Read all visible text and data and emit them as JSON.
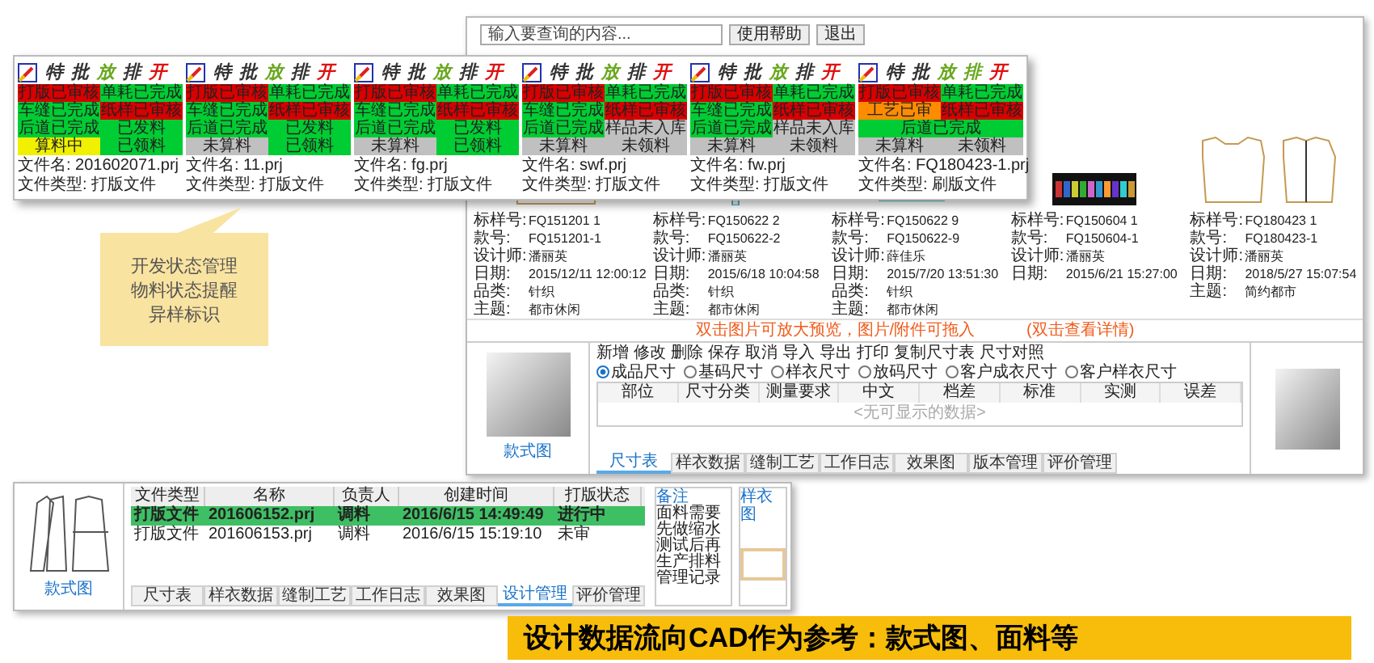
{
  "main_window": {
    "search": {
      "placeholder": "输入要查询的内容..."
    },
    "buttons": [
      "使用帮助",
      "退出"
    ],
    "styles": [
      {
        "kind": "curve",
        "fields": [
          {
            "label": "标样号:",
            "value": "FQ151201 1"
          },
          {
            "label": "款号:",
            "value": "FQ151201-1"
          },
          {
            "label": "设计师:",
            "value": "潘丽英"
          },
          {
            "label": "日期:",
            "value": "2015/12/11 12:00:12"
          },
          {
            "label": "品类:",
            "value": "针织"
          },
          {
            "label": "主题:",
            "value": "都市休闲"
          }
        ]
      },
      {
        "kind": "ruler",
        "fields": [
          {
            "label": "标样号:",
            "value": "FQ150622 2"
          },
          {
            "label": "款号:",
            "value": "FQ150622-2"
          },
          {
            "label": "设计师:",
            "value": "潘丽英"
          },
          {
            "label": "日期:",
            "value": "2015/6/18 10:04:58"
          },
          {
            "label": "品类:",
            "value": "针织"
          },
          {
            "label": "主题:",
            "value": "都市休闲"
          }
        ]
      },
      {
        "kind": "pattern",
        "fields": [
          {
            "label": "标样号:",
            "value": "FQ150622 9"
          },
          {
            "label": "款号:",
            "value": "FQ150622-9"
          },
          {
            "label": "设计师:",
            "value": "薛佳乐"
          },
          {
            "label": "日期:",
            "value": "2015/7/20 13:51:30"
          },
          {
            "label": "品类:",
            "value": "针织"
          },
          {
            "label": "主题:",
            "value": "都市休闲"
          }
        ]
      },
      {
        "kind": "fabric",
        "fields": [
          {
            "label": "标样号:",
            "value": "FQ150604 1"
          },
          {
            "label": "款号:",
            "value": "FQ150604-1"
          },
          {
            "label": "设计师:",
            "value": "潘丽英"
          },
          {
            "label": "日期:",
            "value": "2015/6/21 15:27:00"
          }
        ]
      },
      {
        "kind": "vest",
        "fields": [
          {
            "label": "标样号:",
            "value": "FQ180423 1"
          },
          {
            "label": "款号:",
            "value": "FQ180423-1"
          },
          {
            "label": "设计师:",
            "value": "潘丽英"
          },
          {
            "label": "日期:",
            "value": "2018/5/27 15:07:54"
          },
          {
            "label": "主题:",
            "value": "简约都市"
          }
        ]
      }
    ],
    "notice": "双击图片可放大预览，图片/附件可拖入",
    "notice_2": "(双击查看详情)",
    "photo_caption": "款式图",
    "toolbar": [
      "新增",
      "修改",
      "删除",
      "保存",
      "取消",
      "导入",
      "导出",
      "打印",
      "复制尺寸表",
      "尺寸对照"
    ],
    "radios": [
      {
        "label": "成品尺寸",
        "selected": true
      },
      {
        "label": "基码尺寸",
        "selected": false
      },
      {
        "label": "样衣尺寸",
        "selected": false
      },
      {
        "label": "放码尺寸",
        "selected": false
      },
      {
        "label": "客户成衣尺寸",
        "selected": false
      },
      {
        "label": "客户样衣尺寸",
        "selected": false
      }
    ],
    "size_table": {
      "columns": [
        "部位",
        "尺寸分类",
        "测量要求",
        "中文",
        "档差",
        "标准",
        "实测",
        "误差"
      ],
      "empty": "<无可显示的数据>"
    },
    "tabs": [
      {
        "label": "尺寸表",
        "selected": true
      },
      {
        "label": "样衣数据",
        "selected": false
      },
      {
        "label": "缝制工艺",
        "selected": false
      },
      {
        "label": "工作日志",
        "selected": false
      },
      {
        "label": "效果图",
        "selected": false
      },
      {
        "label": "版本管理",
        "selected": false
      },
      {
        "label": "评价管理",
        "selected": false
      }
    ]
  },
  "status_popup": {
    "cards": [
      {
        "logo": [
          {
            "char": "特",
            "color": "#333333"
          },
          {
            "char": "批",
            "color": "#333333"
          },
          {
            "char": "放",
            "color": "#6aa820"
          },
          {
            "char": "排",
            "color": "#333333"
          },
          {
            "char": "开",
            "color": "#e01010"
          }
        ],
        "chips": [
          {
            "label": "打版已审核",
            "color": "#d80000",
            "kind": "half"
          },
          {
            "label": "单耗已完成",
            "color": "#00cc33",
            "kind": "half"
          },
          {
            "label": "车缝已完成",
            "color": "#00cc33",
            "kind": "half"
          },
          {
            "label": "纸样已审核",
            "color": "#d80000",
            "kind": "half"
          },
          {
            "label": "后道已完成",
            "color": "#00cc33",
            "kind": "half"
          },
          {
            "label": "已发料",
            "color": "#00cc33",
            "kind": "half"
          },
          {
            "label": "算料中",
            "color": "#f0f000",
            "kind": "half"
          },
          {
            "label": "已领料",
            "color": "#00cc33",
            "kind": "half"
          }
        ],
        "file_name": "文件名:  201602071.prj",
        "file_type": "文件类型:  打版文件"
      },
      {
        "logo": [
          {
            "char": "特",
            "color": "#333333"
          },
          {
            "char": "批",
            "color": "#333333"
          },
          {
            "char": "放",
            "color": "#6aa820"
          },
          {
            "char": "排",
            "color": "#333333"
          },
          {
            "char": "开",
            "color": "#e01010"
          }
        ],
        "chips": [
          {
            "label": "打版已审核",
            "color": "#d80000",
            "kind": "half"
          },
          {
            "label": "单耗已完成",
            "color": "#00cc33",
            "kind": "half"
          },
          {
            "label": "车缝已完成",
            "color": "#00cc33",
            "kind": "half"
          },
          {
            "label": "纸样已审核",
            "color": "#d80000",
            "kind": "half"
          },
          {
            "label": "后道已完成",
            "color": "#00cc33",
            "kind": "half"
          },
          {
            "label": "已发料",
            "color": "#00cc33",
            "kind": "half"
          },
          {
            "label": "未算料",
            "color": "#c0c0c0",
            "kind": "half"
          },
          {
            "label": "已领料",
            "color": "#00cc33",
            "kind": "half"
          }
        ],
        "file_name": "文件名:  11.prj",
        "file_type": "文件类型:  打版文件"
      },
      {
        "logo": [
          {
            "char": "特",
            "color": "#333333"
          },
          {
            "char": "批",
            "color": "#333333"
          },
          {
            "char": "放",
            "color": "#6aa820"
          },
          {
            "char": "排",
            "color": "#333333"
          },
          {
            "char": "开",
            "color": "#e01010"
          }
        ],
        "chips": [
          {
            "label": "打版已审核",
            "color": "#d80000",
            "kind": "half"
          },
          {
            "label": "单耗已完成",
            "color": "#00cc33",
            "kind": "half"
          },
          {
            "label": "车缝已完成",
            "color": "#00cc33",
            "kind": "half"
          },
          {
            "label": "纸样已审核",
            "color": "#d80000",
            "kind": "half"
          },
          {
            "label": "后道已完成",
            "color": "#00cc33",
            "kind": "half"
          },
          {
            "label": "已发料",
            "color": "#00cc33",
            "kind": "half"
          },
          {
            "label": "未算料",
            "color": "#c0c0c0",
            "kind": "half"
          },
          {
            "label": "已领料",
            "color": "#00cc33",
            "kind": "half"
          }
        ],
        "file_name": "文件名:  fg.prj",
        "file_type": "文件类型:  打版文件"
      },
      {
        "logo": [
          {
            "char": "特",
            "color": "#333333"
          },
          {
            "char": "批",
            "color": "#333333"
          },
          {
            "char": "放",
            "color": "#6aa820"
          },
          {
            "char": "排",
            "color": "#333333"
          },
          {
            "char": "开",
            "color": "#e01010"
          }
        ],
        "chips": [
          {
            "label": "打版已审核",
            "color": "#d80000",
            "kind": "half"
          },
          {
            "label": "单耗已完成",
            "color": "#00cc33",
            "kind": "half"
          },
          {
            "label": "车缝已完成",
            "color": "#00cc33",
            "kind": "half"
          },
          {
            "label": "纸样已审核",
            "color": "#d80000",
            "kind": "half"
          },
          {
            "label": "后道已完成",
            "color": "#00cc33",
            "kind": "half"
          },
          {
            "label": "样品未入库",
            "color": "#c0c0c0",
            "kind": "half"
          },
          {
            "label": "未算料",
            "color": "#c0c0c0",
            "kind": "half"
          },
          {
            "label": "未领料",
            "color": "#c0c0c0",
            "kind": "half"
          }
        ],
        "file_name": "文件名:  swf.prj",
        "file_type": "文件类型:  打版文件"
      },
      {
        "logo": [
          {
            "char": "特",
            "color": "#333333"
          },
          {
            "char": "批",
            "color": "#333333"
          },
          {
            "char": "放",
            "color": "#6aa820"
          },
          {
            "char": "排",
            "color": "#333333"
          },
          {
            "char": "开",
            "color": "#e01010"
          }
        ],
        "chips": [
          {
            "label": "打版已审核",
            "color": "#d80000",
            "kind": "half"
          },
          {
            "label": "单耗已完成",
            "color": "#00cc33",
            "kind": "half"
          },
          {
            "label": "车缝已完成",
            "color": "#00cc33",
            "kind": "half"
          },
          {
            "label": "纸样已审核",
            "color": "#d80000",
            "kind": "half"
          },
          {
            "label": "后道已完成",
            "color": "#00cc33",
            "kind": "half"
          },
          {
            "label": "样品未入库",
            "color": "#c0c0c0",
            "kind": "half"
          },
          {
            "label": "未算料",
            "color": "#c0c0c0",
            "kind": "half"
          },
          {
            "label": "未领料",
            "color": "#c0c0c0",
            "kind": "half"
          }
        ],
        "file_name": "文件名:  fw.prj",
        "file_type": "文件类型:  打版文件"
      },
      {
        "logo": [
          {
            "char": "特",
            "color": "#333333"
          },
          {
            "char": "批",
            "color": "#333333"
          },
          {
            "char": "放",
            "color": "#6aa820"
          },
          {
            "char": "排",
            "color": "#6aa820"
          },
          {
            "char": "开",
            "color": "#e01010"
          }
        ],
        "chips": [
          {
            "label": "打版已审核",
            "color": "#d80000",
            "kind": "half"
          },
          {
            "label": "单耗已完成",
            "color": "#00cc33",
            "kind": "half"
          },
          {
            "label": "工艺已审",
            "color": "#ff8c00",
            "kind": "half"
          },
          {
            "label": "纸样已审核",
            "color": "#d80000",
            "kind": "half"
          },
          {
            "label": "后道已完成",
            "color": "#00cc33",
            "kind": "full"
          },
          {
            "label": "未算料",
            "color": "#c0c0c0",
            "kind": "half"
          },
          {
            "label": "未领料",
            "color": "#c0c0c0",
            "kind": "half"
          }
        ],
        "file_name": "文件名:  FQ180423-1.prj",
        "file_type": "文件类型:  刷版文件"
      }
    ]
  },
  "callout": {
    "lines": [
      "开发状态管理",
      "物料状态提醒",
      "异样标识"
    ]
  },
  "design_window": {
    "drawing_caption": "款式图",
    "table": {
      "columns": [
        "文件类型",
        "名称",
        "负责人",
        "创建时间",
        "打版状态"
      ],
      "rows": [
        {
          "selected": true,
          "cells": [
            "打版文件",
            "201606152.prj",
            "调料",
            "2016/6/15 14:49:49",
            "进行中"
          ]
        },
        {
          "selected": false,
          "cells": [
            "打版文件",
            "201606153.prj",
            "调料",
            "2016/6/15 15:19:10",
            "未审"
          ]
        }
      ]
    },
    "tabs": [
      {
        "label": "尺寸表",
        "selected": false
      },
      {
        "label": "样衣数据",
        "selected": false
      },
      {
        "label": "缝制工艺",
        "selected": false
      },
      {
        "label": "工作日志",
        "selected": false
      },
      {
        "label": "效果图",
        "selected": false
      },
      {
        "label": "设计管理",
        "selected": true
      },
      {
        "label": "评价管理",
        "selected": false
      }
    ],
    "notes_title": "备注",
    "notes_text": "面料需要先做缩水测试后再生产排料管理记录",
    "thumb_title": "样衣图"
  },
  "banner": "设计数据流向CAD作为参考：款式图、面料等"
}
